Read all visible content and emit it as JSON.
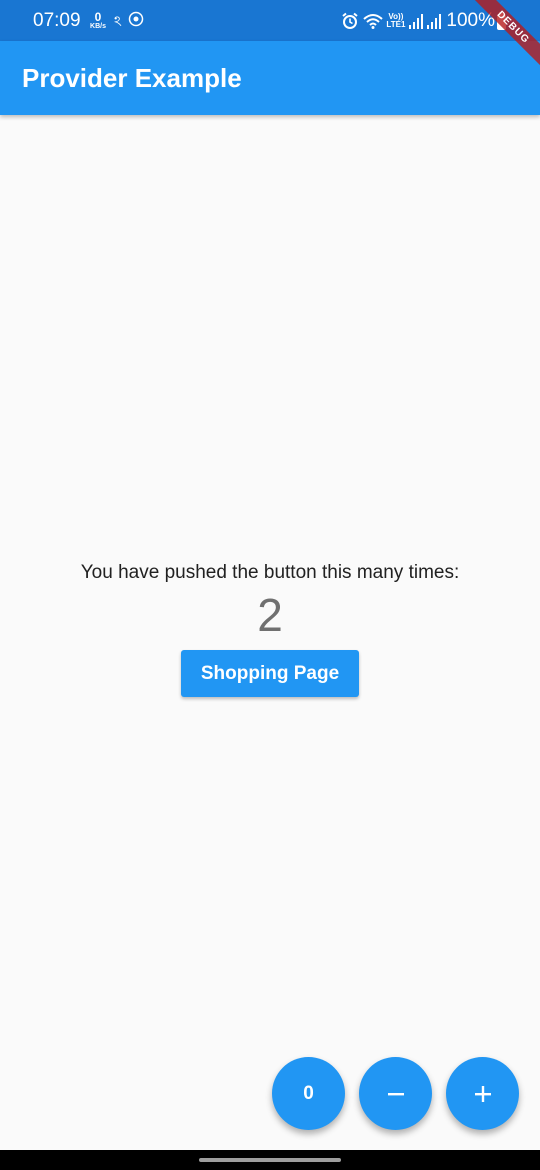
{
  "status_bar": {
    "time": "07:09",
    "net_speed_value": "0",
    "net_speed_unit": "KB/s",
    "carrier_glyph": "ঽ",
    "volte_top": "Vo))",
    "volte_bottom": "LTE1",
    "battery": "100%",
    "icons": [
      "alarm-icon",
      "wifi-icon",
      "signal-icon",
      "signal-icon",
      "battery-icon"
    ],
    "color": "#1976d2"
  },
  "app_bar": {
    "title": "Provider Example",
    "color": "#2196f3"
  },
  "debug_banner": {
    "label": "DEBUG"
  },
  "main": {
    "counter_label": "You have pushed the button this many times:",
    "counter_value": "2",
    "shopping_button_label": "Shopping Page"
  },
  "fabs": {
    "count_label": "0",
    "minus_icon": "minus-icon",
    "plus_icon": "plus-icon",
    "color": "#2196f3"
  }
}
